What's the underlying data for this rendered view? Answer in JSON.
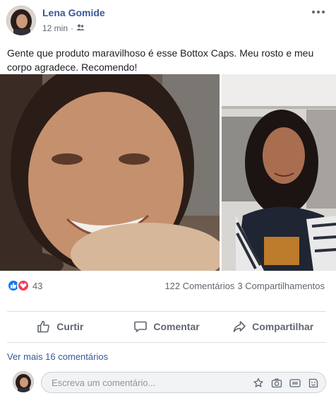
{
  "post": {
    "author": "Lena Gomide",
    "time": "12 min",
    "separator": "·",
    "audience_icon": "friends-icon",
    "text": "Gente que produto maravilhoso é esse Bottox Caps. Meu rosto e meu corpo agradece. Recomendo!",
    "photos": [
      "photo-left",
      "photo-right"
    ]
  },
  "reactions": {
    "icons": [
      "like-icon",
      "love-icon"
    ],
    "count": "43",
    "comments": "122 Comentários",
    "shares": "3 Compartilhamentos"
  },
  "actions": {
    "like": "Curtir",
    "comment": "Comentar",
    "share": "Compartilhar"
  },
  "comments": {
    "more": "Ver mais 16 comentários",
    "placeholder": "Escreva um comentário...",
    "composer_icons": [
      "sticker-icon",
      "camera-icon",
      "gif-icon",
      "emoji-icon"
    ]
  },
  "colors": {
    "link": "#385898",
    "like": "#1877f2",
    "love": "#f33e58",
    "muted": "#606770"
  }
}
